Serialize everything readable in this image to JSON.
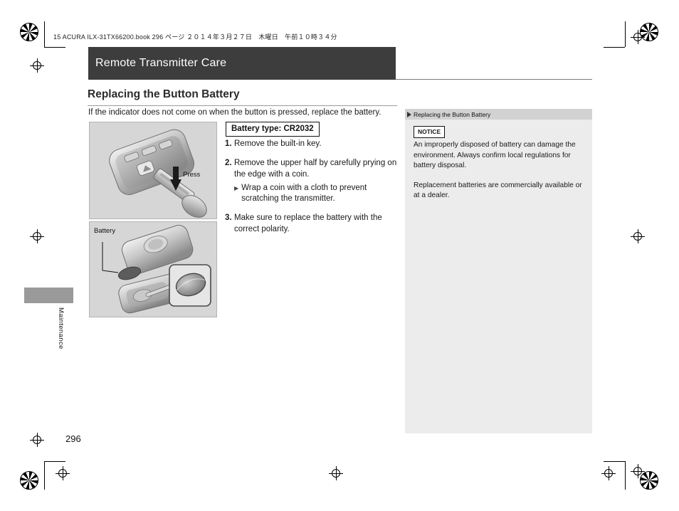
{
  "header": {
    "running_head": "15 ACURA ILX-31TX66200.book   296 ページ   ２０１４年３月２７日　木曜日　午前１０時３４分"
  },
  "title_bar": {
    "title": "Remote Transmitter Care"
  },
  "section": {
    "title": "Replacing the Button Battery",
    "intro": "If the indicator does not come on when the button is pressed, replace the battery."
  },
  "battery_type": {
    "label": "Battery type: CR2032"
  },
  "figures": {
    "key_press_label": "Press",
    "battery_label": "Battery"
  },
  "steps": [
    {
      "num": "1.",
      "text": "Remove the built-in key.",
      "sub": []
    },
    {
      "num": "2.",
      "text": "Remove the upper half by carefully prying on the edge with a coin.",
      "sub": [
        "Wrap a coin with a cloth to prevent scratching the transmitter."
      ]
    },
    {
      "num": "3.",
      "text": "Make sure to replace the battery with the correct polarity.",
      "sub": []
    }
  ],
  "side_panel": {
    "head": "Replacing the Button Battery",
    "notice_tag": "NOTICE",
    "paragraphs": [
      "An improperly disposed of battery can damage the environment. Always confirm local regulations for battery disposal.",
      "Replacement batteries are commercially available or at a dealer."
    ]
  },
  "tab": {
    "label": "Maintenance"
  },
  "page_number": "296",
  "colors": {
    "title_bar_bg": "#3d3d3d",
    "side_panel_bg": "#ececec",
    "side_head_bg": "#d2d2d2",
    "figure_bg": "#d6d6d6",
    "tab_bg": "#9a9a9a"
  }
}
